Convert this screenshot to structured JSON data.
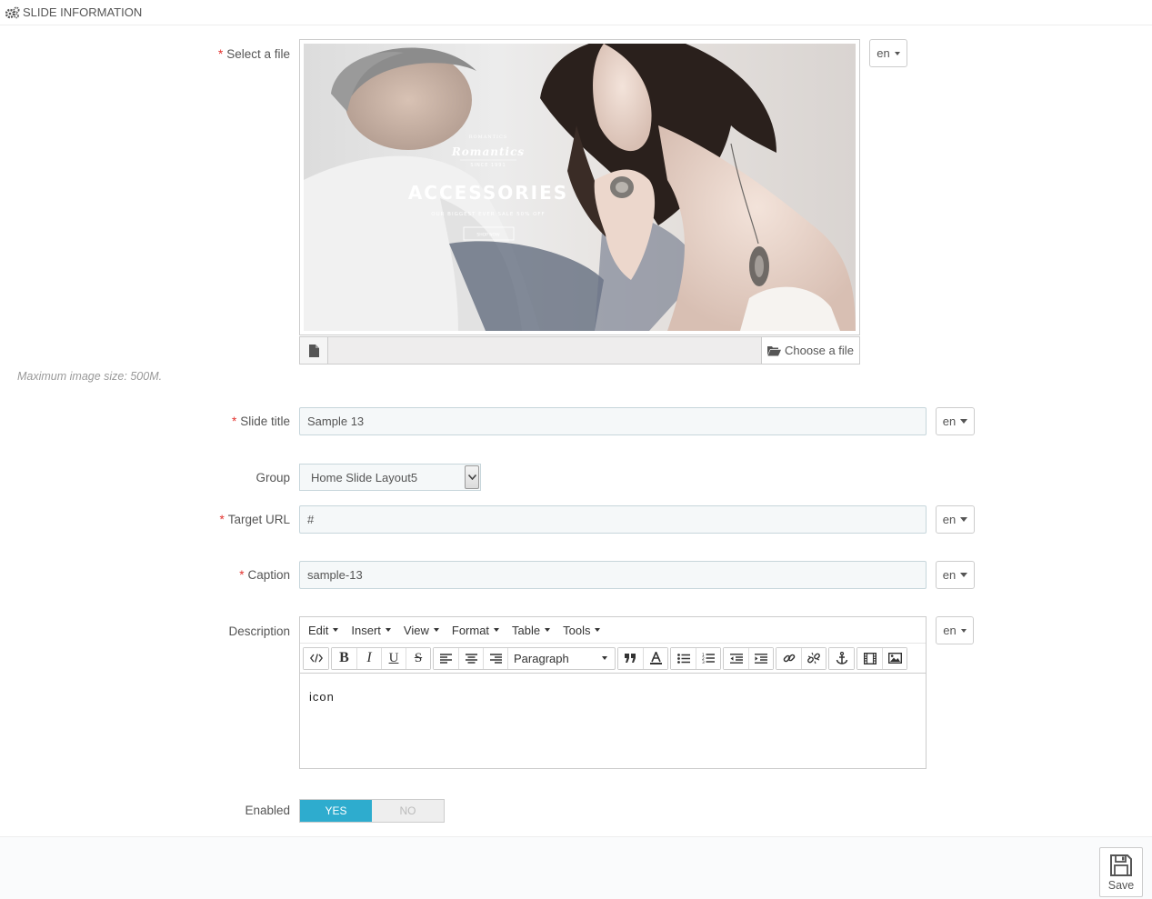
{
  "panel": {
    "title": "SLIDE INFORMATION"
  },
  "image_field": {
    "label": "Select a file",
    "required": "*",
    "lang": "en",
    "choose_label": "Choose a file",
    "help": "Maximum image size: 500M.",
    "banner": {
      "brand_top": "ROMANTICS",
      "brand": "Romantics",
      "since": "SINCE 1991",
      "headline": "ACCESSORIES",
      "subline": "OUR BIGGEST EVER SALE 50% OFF",
      "cta": "SHOP NOW"
    }
  },
  "slide_title": {
    "label": "Slide title",
    "required": "*",
    "value": "Sample 13",
    "lang": "en"
  },
  "group": {
    "label": "Group",
    "value": "Home Slide Layout5"
  },
  "target_url": {
    "label": "Target URL",
    "required": "*",
    "value": "#",
    "lang": "en"
  },
  "caption": {
    "label": "Caption",
    "required": "*",
    "value": "sample-13",
    "lang": "en"
  },
  "description": {
    "label": "Description",
    "lang": "en",
    "menus": [
      "Edit",
      "Insert",
      "View",
      "Format",
      "Table",
      "Tools"
    ],
    "format_value": "Paragraph",
    "content": "icon"
  },
  "enabled": {
    "label": "Enabled",
    "yes": "YES",
    "no": "NO",
    "value": "yes"
  },
  "footer": {
    "save_label": "Save"
  },
  "colors": {
    "accent": "#2eacce",
    "required": "#e3322e"
  }
}
